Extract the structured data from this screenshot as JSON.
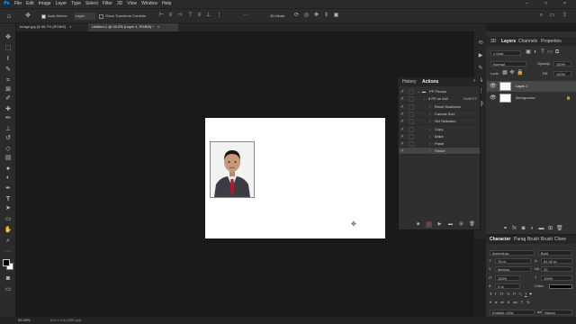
{
  "menubar": {
    "logo": "Ps",
    "items": [
      "File",
      "Edit",
      "Image",
      "Layer",
      "Type",
      "Select",
      "Filter",
      "3D",
      "View",
      "Window",
      "Help"
    ]
  },
  "options": {
    "auto_select_label": "Auto-Select:",
    "auto_select_value": "Layer",
    "show_transform_label": "Show Transform Controls",
    "mode_3d_label": "3D Mode:"
  },
  "tabs": [
    {
      "label": "Image.jpg @ 66.7% (RGB/8)",
      "close": "×"
    },
    {
      "label": "Untitled-1 @ 33.3% (Layer 1, RGB/8) *",
      "close": "×"
    }
  ],
  "layers_panel": {
    "tabs": [
      "3D",
      "Layers",
      "Channels",
      "Properties"
    ],
    "kind_label": "Kind",
    "blend_mode": "Normal",
    "opacity_label": "Opacity:",
    "opacity_value": "100%",
    "lock_label": "Lock:",
    "fill_label": "Fill:",
    "fill_value": "100%",
    "layers": [
      {
        "name": "Layer 1",
        "selected": true
      },
      {
        "name": "Background",
        "selected": false
      }
    ]
  },
  "actions_panel": {
    "tabs": [
      "History",
      "Actions"
    ],
    "rows": [
      {
        "label": "PP Photos",
        "level": 0,
        "folder": true,
        "shortcut": ""
      },
      {
        "label": "8 PP on 4x6",
        "level": 1,
        "shortcut": "Shift+F2"
      },
      {
        "label": "Reset Swatches",
        "level": 2,
        "shortcut": ""
      },
      {
        "label": "Canvas Size",
        "level": 2,
        "shortcut": ""
      },
      {
        "label": "Set Selection",
        "level": 2,
        "shortcut": ""
      },
      {
        "label": "Copy",
        "level": 2,
        "shortcut": ""
      },
      {
        "label": "Make",
        "level": 2,
        "shortcut": ""
      },
      {
        "label": "Paste",
        "level": 2,
        "shortcut": ""
      },
      {
        "label": "Stroke",
        "level": 2,
        "shortcut": ""
      }
    ]
  },
  "character_panel": {
    "tabs": [
      "Character",
      "Parag",
      "Brush",
      "Brush",
      "Clone"
    ],
    "font_family": "ArmedLgs",
    "font_style": "Bold",
    "font_size": "76 pt",
    "leading": "61.32 pt",
    "kerning": "Metrics",
    "tracking": "20",
    "vertical_scale": "100%",
    "horizontal_scale": "100%",
    "baseline": "0 pt",
    "color_label": "Color:",
    "language": "English: USA",
    "antialias": "Strong"
  },
  "status": {
    "zoom": "33.33%",
    "doc_info": "6 in x 4 in (300 ppi)"
  },
  "colors": {
    "accent": "#1473e6",
    "record": "#d9231f"
  }
}
